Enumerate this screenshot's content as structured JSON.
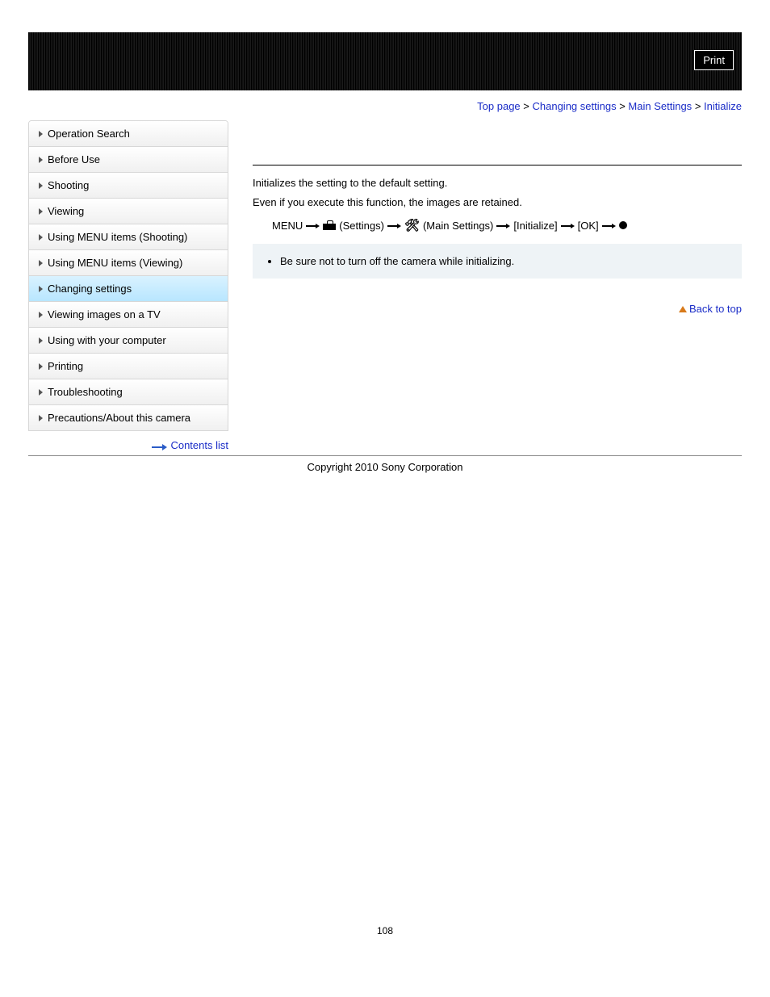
{
  "header": {
    "print_label": "Print"
  },
  "breadcrumb": {
    "items": [
      "Top page",
      "Changing settings",
      "Main Settings",
      "Initialize"
    ],
    "separator": ">"
  },
  "sidebar": {
    "items": [
      {
        "label": "Operation Search",
        "active": false
      },
      {
        "label": "Before Use",
        "active": false
      },
      {
        "label": "Shooting",
        "active": false
      },
      {
        "label": "Viewing",
        "active": false
      },
      {
        "label": "Using MENU items (Shooting)",
        "active": false
      },
      {
        "label": "Using MENU items (Viewing)",
        "active": false
      },
      {
        "label": "Changing settings",
        "active": true
      },
      {
        "label": "Viewing images on a TV",
        "active": false
      },
      {
        "label": "Using with your computer",
        "active": false
      },
      {
        "label": "Printing",
        "active": false
      },
      {
        "label": "Troubleshooting",
        "active": false
      },
      {
        "label": "Precautions/About this camera",
        "active": false
      }
    ],
    "contents_list_label": "Contents list"
  },
  "content": {
    "paragraphs": [
      "Initializes the setting to the default setting.",
      "Even if you execute this function, the images are retained."
    ],
    "menu_path": {
      "menu": "MENU",
      "settings": "(Settings)",
      "main_settings": "(Main Settings)",
      "initialize": "[Initialize]",
      "ok": "[OK]"
    },
    "note_items": [
      "Be sure not to turn off the camera while initializing."
    ],
    "back_to_top": "Back to top"
  },
  "footer": {
    "copyright": "Copyright 2010 Sony Corporation",
    "page_number": "108"
  }
}
